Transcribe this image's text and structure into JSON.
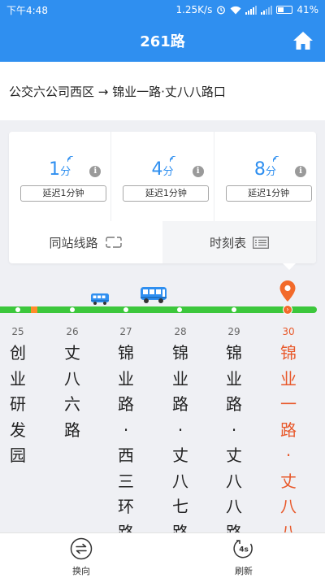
{
  "status_bar": {
    "time": "下午4:48",
    "speed": "1.25K/s",
    "battery": "41%"
  },
  "nav": {
    "title": "261路"
  },
  "route": {
    "direction": "公交六公司西区 → 锦业一路·丈八八路口"
  },
  "arrivals": [
    {
      "minutes": "1",
      "unit": "分",
      "delay": "延迟1分钟"
    },
    {
      "minutes": "4",
      "unit": "分",
      "delay": "延迟1分钟"
    },
    {
      "minutes": "8",
      "unit": "分",
      "delay": "延迟1分钟"
    }
  ],
  "tabs": {
    "same_station": "同站线路",
    "timetable": "时刻表"
  },
  "line": {
    "line_color": "#3cc73c",
    "congestion_color": "#ff8c2a",
    "current_color": "#e8592b"
  },
  "stops": [
    {
      "num": "25",
      "name": "创业研发园",
      "current": false
    },
    {
      "num": "26",
      "name": "丈八六路",
      "current": false
    },
    {
      "num": "27",
      "name": "锦业路·西三环路口",
      "current": false
    },
    {
      "num": "28",
      "name": "锦业路·丈八七路口",
      "current": false
    },
    {
      "num": "29",
      "name": "锦业路·丈八八路口",
      "current": false
    },
    {
      "num": "30",
      "name": "锦业一路·丈八八路口",
      "current": true
    }
  ],
  "bottom": {
    "switch_label": "换向",
    "refresh_label": "刷新",
    "refresh_countdown": "4s"
  }
}
